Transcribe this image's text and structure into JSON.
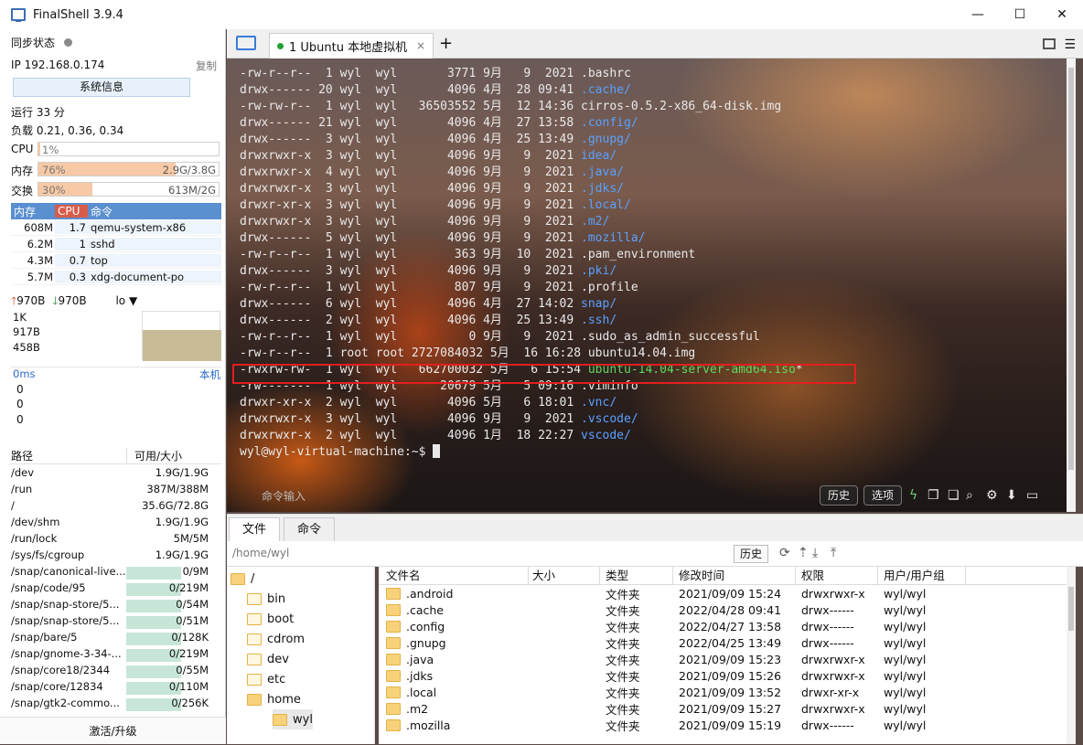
{
  "window": {
    "title": "FinalShell 3.9.4",
    "min": "—",
    "max": "☐",
    "close": "✕"
  },
  "sidebar": {
    "sync_label": "同步状态",
    "ip": "IP 192.168.0.174",
    "copy": "复制",
    "sysinfo": "系统信息",
    "uptime": "运行 33 分",
    "load": "负载 0.21, 0.36, 0.34",
    "cpu": {
      "label": "CPU",
      "pct": "1%",
      "level": 0.01
    },
    "mem": {
      "label": "内存",
      "pct": "76%",
      "val": "2.9G/3.8G",
      "level": 0.76
    },
    "swap": {
      "label": "交换",
      "pct": "30%",
      "val": "613M/2G",
      "level": 0.3
    },
    "proc_headers": [
      "内存",
      "CPU",
      "命令"
    ],
    "procs": [
      {
        "mem": "608M",
        "cpu": "1.7",
        "cmd": "qemu-system-x86"
      },
      {
        "mem": "6.2M",
        "cpu": "1",
        "cmd": "sshd"
      },
      {
        "mem": "4.3M",
        "cpu": "0.7",
        "cmd": "top"
      },
      {
        "mem": "5.7M",
        "cpu": "0.3",
        "cmd": "xdg-document-po"
      }
    ],
    "net": {
      "up": "970B",
      "down": "970B",
      "iface": "lo",
      "ticks": [
        "1K",
        "917B",
        "458B"
      ]
    },
    "ping": {
      "label": "0ms",
      "host": "本机",
      "vals": [
        "0",
        "0",
        "0"
      ]
    },
    "disk_headers": [
      "路径",
      "可用/大小"
    ],
    "disks": [
      {
        "path": "/dev",
        "usage": "1.9G/1.9G",
        "level": 0
      },
      {
        "path": "/run",
        "usage": "387M/388M",
        "level": 0
      },
      {
        "path": "/",
        "usage": "35.6G/72.8G",
        "level": 0
      },
      {
        "path": "/dev/shm",
        "usage": "1.9G/1.9G",
        "level": 0
      },
      {
        "path": "/run/lock",
        "usage": "5M/5M",
        "level": 0
      },
      {
        "path": "/sys/fs/cgroup",
        "usage": "1.9G/1.9G",
        "level": 0
      },
      {
        "path": "/snap/canonical-live...",
        "usage": "0/9M",
        "level": 1
      },
      {
        "path": "/snap/code/95",
        "usage": "0/219M",
        "level": 1
      },
      {
        "path": "/snap/snap-store/5...",
        "usage": "0/54M",
        "level": 1
      },
      {
        "path": "/snap/snap-store/5...",
        "usage": "0/51M",
        "level": 1
      },
      {
        "path": "/snap/bare/5",
        "usage": "0/128K",
        "level": 1
      },
      {
        "path": "/snap/gnome-3-34-...",
        "usage": "0/219M",
        "level": 1
      },
      {
        "path": "/snap/core18/2344",
        "usage": "0/55M",
        "level": 1
      },
      {
        "path": "/snap/core/12834",
        "usage": "0/110M",
        "level": 1
      },
      {
        "path": "/snap/gtk2-commo...",
        "usage": "0/256K",
        "level": 1
      }
    ],
    "upgrade": "激活/升级"
  },
  "tab": {
    "label": "1 Ubuntu 本地虚拟机",
    "close": "×",
    "add": "+"
  },
  "terminal": {
    "lines": [
      {
        "meta": "-rw-r--r--  1 wyl  wyl       3771 9月   9  2021 ",
        "name": ".bashrc",
        "c": ""
      },
      {
        "meta": "drwx------ 20 wyl  wyl       4096 4月  28 09:41 ",
        "name": ".cache/",
        "c": "blue"
      },
      {
        "meta": "-rw-rw-r--  1 wyl  wyl   36503552 5月  12 14:36 ",
        "name": "cirros-0.5.2-x86_64-disk.img",
        "c": ""
      },
      {
        "meta": "drwx------ 21 wyl  wyl       4096 4月  27 13:58 ",
        "name": ".config/",
        "c": "blue"
      },
      {
        "meta": "drwx------  3 wyl  wyl       4096 4月  25 13:49 ",
        "name": ".gnupg/",
        "c": "blue"
      },
      {
        "meta": "drwxrwxr-x  3 wyl  wyl       4096 9月   9  2021 ",
        "name": "idea/",
        "c": "blue"
      },
      {
        "meta": "drwxrwxr-x  4 wyl  wyl       4096 9月   9  2021 ",
        "name": ".java/",
        "c": "blue"
      },
      {
        "meta": "drwxrwxr-x  3 wyl  wyl       4096 9月   9  2021 ",
        "name": ".jdks/",
        "c": "blue"
      },
      {
        "meta": "drwxr-xr-x  3 wyl  wyl       4096 9月   9  2021 ",
        "name": ".local/",
        "c": "blue"
      },
      {
        "meta": "drwxrwxr-x  3 wyl  wyl       4096 9月   9  2021 ",
        "name": ".m2/",
        "c": "blue"
      },
      {
        "meta": "drwx------  5 wyl  wyl       4096 9月   9  2021 ",
        "name": ".mozilla/",
        "c": "blue"
      },
      {
        "meta": "-rw-r--r--  1 wyl  wyl        363 9月  10  2021 ",
        "name": ".pam_environment",
        "c": ""
      },
      {
        "meta": "drwx------  3 wyl  wyl       4096 9月   9  2021 ",
        "name": ".pki/",
        "c": "blue"
      },
      {
        "meta": "-rw-r--r--  1 wyl  wyl        807 9月   9  2021 ",
        "name": ".profile",
        "c": ""
      },
      {
        "meta": "drwx------  6 wyl  wyl       4096 4月  27 14:02 ",
        "name": "snap/",
        "c": "blue"
      },
      {
        "meta": "drwx------  2 wyl  wyl       4096 4月  25 13:49 ",
        "name": ".ssh/",
        "c": "blue"
      },
      {
        "meta": "-rw-r--r--  1 wyl  wyl          0 9月   9  2021 ",
        "name": ".sudo_as_admin_successful",
        "c": ""
      },
      {
        "meta": "-rw-r--r--  1 root root 2727084032 5月  16 16:28 ",
        "name": "ubuntu14.04.img",
        "c": ""
      },
      {
        "meta": "-rwxrw-rw-  1 wyl  wyl   662700032 5月   6 15:54 ",
        "name": "ubuntu-14.04-server-amd64.iso",
        "c": "green",
        "suffix": "*"
      },
      {
        "meta": "-rw-------  1 wyl  wyl      20679 5月   5 09:16 ",
        "name": ".viminfo",
        "c": ""
      },
      {
        "meta": "drwxr-xr-x  2 wyl  wyl       4096 5月   6 18:01 ",
        "name": ".vnc/",
        "c": "blue"
      },
      {
        "meta": "drwxrwxr-x  3 wyl  wyl       4096 9月   9  2021 ",
        "name": ".vscode/",
        "c": "blue"
      },
      {
        "meta": "drwxrwxr-x  2 wyl  wyl       4096 1月  18 22:27 ",
        "name": "vscode/",
        "c": "blue"
      }
    ],
    "prompt": "wyl@wyl-virtual-machine:~$ ",
    "cmd_placeholder": "命令输入",
    "history_btn": "历史",
    "options_btn": "选项"
  },
  "bottom_tabs": [
    "文件",
    "命令"
  ],
  "path": "/home/wyl",
  "path_history": "历史",
  "tree": [
    {
      "name": "/",
      "level": 0
    },
    {
      "name": "bin",
      "level": 1
    },
    {
      "name": "boot",
      "level": 1
    },
    {
      "name": "cdrom",
      "level": 1
    },
    {
      "name": "dev",
      "level": 1
    },
    {
      "name": "etc",
      "level": 1
    },
    {
      "name": "home",
      "level": 1
    },
    {
      "name": "wyl",
      "level": 2
    }
  ],
  "files": {
    "headers": [
      "文件名",
      "大小",
      "类型",
      "修改时间",
      "权限",
      "用户/用户组"
    ],
    "rows": [
      {
        "name": ".android",
        "type": "文件夹",
        "time": "2021/09/09 15:24",
        "perm": "drwxrwxr-x",
        "owner": "wyl/wyl"
      },
      {
        "name": ".cache",
        "type": "文件夹",
        "time": "2022/04/28 09:41",
        "perm": "drwx------",
        "owner": "wyl/wyl"
      },
      {
        "name": ".config",
        "type": "文件夹",
        "time": "2022/04/27 13:58",
        "perm": "drwx------",
        "owner": "wyl/wyl"
      },
      {
        "name": ".gnupg",
        "type": "文件夹",
        "time": "2022/04/25 13:49",
        "perm": "drwx------",
        "owner": "wyl/wyl"
      },
      {
        "name": ".java",
        "type": "文件夹",
        "time": "2021/09/09 15:23",
        "perm": "drwxrwxr-x",
        "owner": "wyl/wyl"
      },
      {
        "name": ".jdks",
        "type": "文件夹",
        "time": "2021/09/09 15:26",
        "perm": "drwxrwxr-x",
        "owner": "wyl/wyl"
      },
      {
        "name": ".local",
        "type": "文件夹",
        "time": "2021/09/09 13:52",
        "perm": "drwxr-xr-x",
        "owner": "wyl/wyl"
      },
      {
        "name": ".m2",
        "type": "文件夹",
        "time": "2021/09/09 15:27",
        "perm": "drwxrwxr-x",
        "owner": "wyl/wyl"
      },
      {
        "name": ".mozilla",
        "type": "文件夹",
        "time": "2021/09/09 15:19",
        "perm": "drwx------",
        "owner": "wyl/wyl"
      }
    ]
  }
}
